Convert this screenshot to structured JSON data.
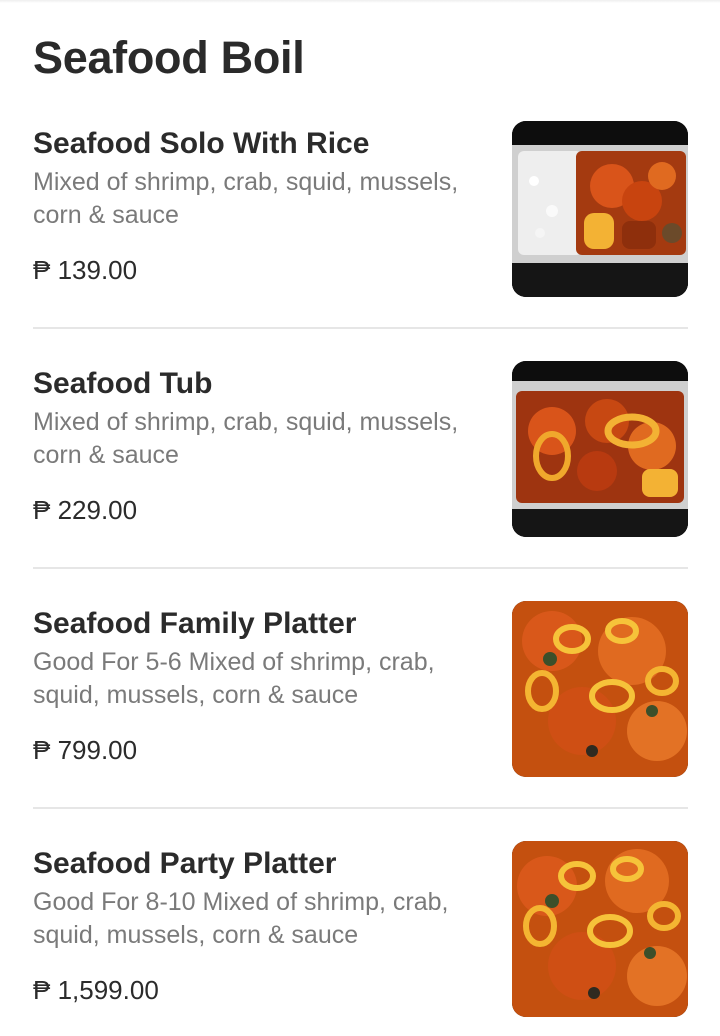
{
  "section": {
    "title": "Seafood Boil"
  },
  "items": [
    {
      "name": "Seafood Solo With Rice",
      "description": "Mixed of shrimp, crab, squid, mussels, corn & sauce",
      "price": "₱ 139.00",
      "photo_icon": "seafood-solo-rice-photo"
    },
    {
      "name": "Seafood Tub",
      "description": "Mixed of shrimp, crab, squid, mussels, corn & sauce",
      "price": "₱ 229.00",
      "photo_icon": "seafood-tub-photo"
    },
    {
      "name": "Seafood Family Platter",
      "description": "Good For 5-6 Mixed of shrimp, crab, squid, mussels, corn & sauce",
      "price": "₱ 799.00",
      "photo_icon": "seafood-family-platter-photo"
    },
    {
      "name": "Seafood Party Platter",
      "description": "Good For 8-10 Mixed of shrimp, crab, squid, mussels, corn & sauce",
      "price": "₱ 1,599.00",
      "photo_icon": "seafood-party-platter-photo"
    }
  ],
  "colors": {
    "title_text": "#2a2a2a",
    "description_text": "#7a7a7a",
    "divider": "#e6e6e6",
    "sauce_orange": "#e0621b"
  }
}
